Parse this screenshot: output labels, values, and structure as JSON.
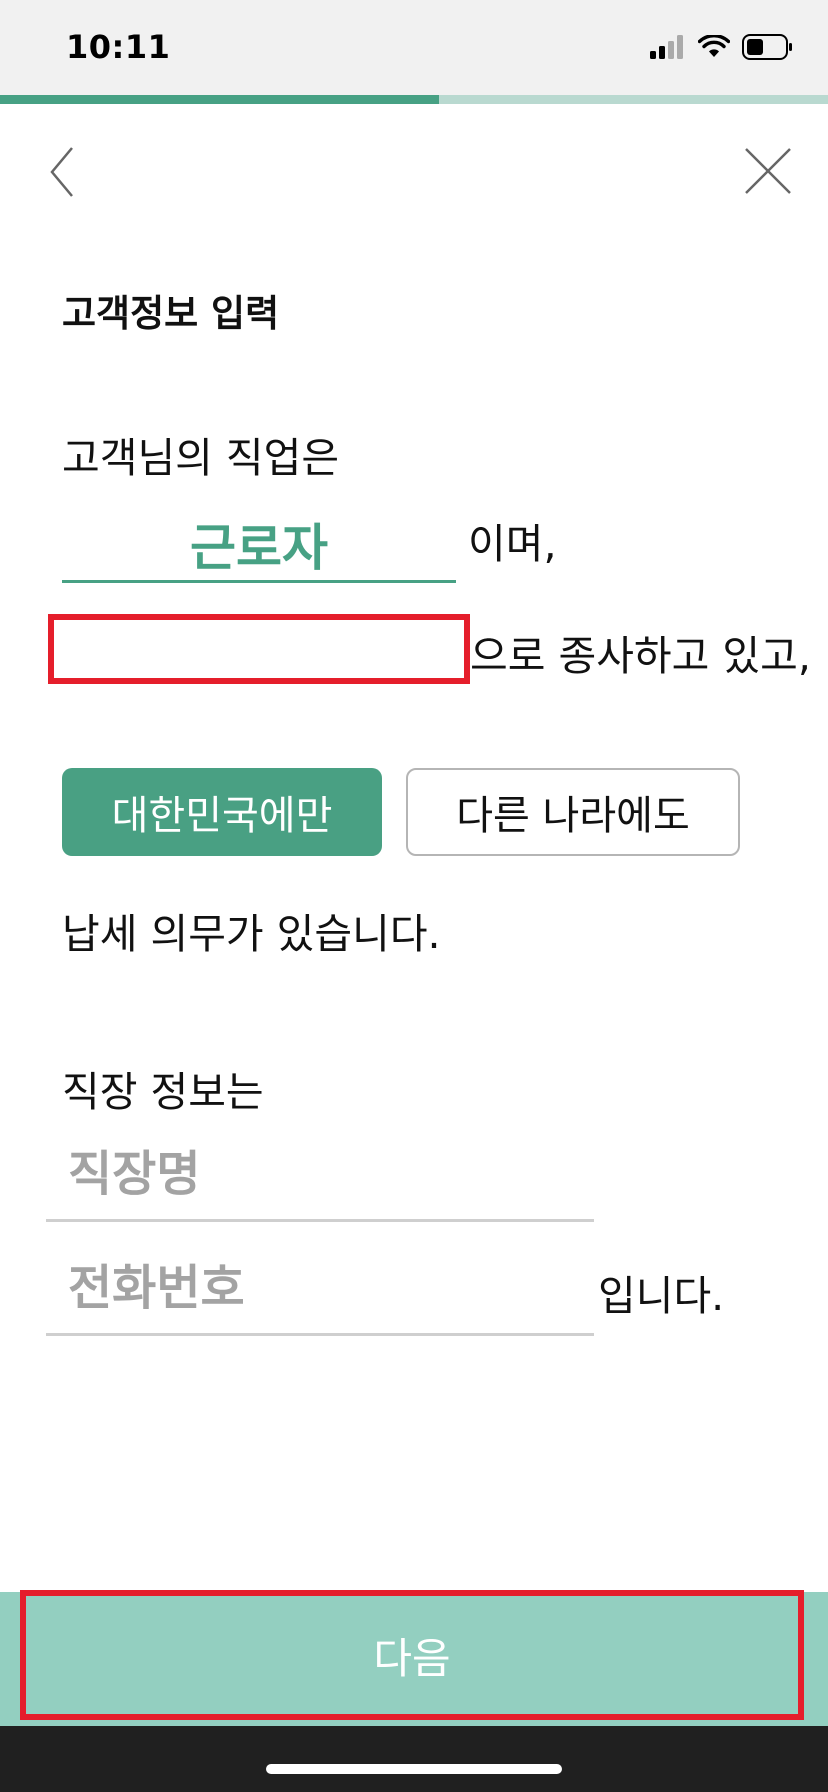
{
  "status_bar": {
    "time": "10:11"
  },
  "progress": {
    "fraction": 0.53,
    "fill_color": "#47a184",
    "track_color": "#b9d9d0"
  },
  "nav": {
    "back_icon": "chevron-left-icon",
    "close_icon": "close-icon"
  },
  "page_title": "고객정보 입력",
  "occupation": {
    "intro": "고객님의 직업은",
    "value": "근로자",
    "suffix": "이며,",
    "role_suffix": "으로 종사하고 있고,"
  },
  "tax": {
    "options": [
      "대한민국에만",
      "다른 나라에도"
    ],
    "selected": "대한민국에만",
    "suffix": "납세 의무가 있습니다."
  },
  "workplace": {
    "intro": "직장 정보는",
    "name_placeholder": "직장명",
    "phone_placeholder": "전화번호",
    "suffix": "입니다."
  },
  "next_button": {
    "label": "다음"
  },
  "colors": {
    "accent": "#47a184",
    "button_bg": "#93cfc0",
    "highlight": "#e51e2b"
  }
}
